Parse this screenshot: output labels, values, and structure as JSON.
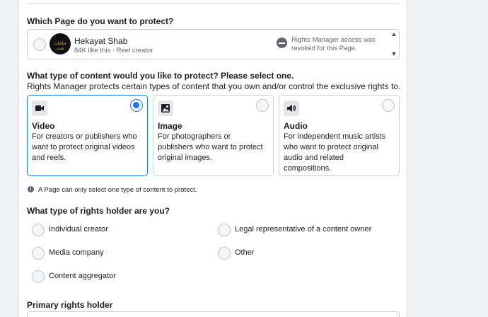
{
  "page_question": {
    "title": "Which Page do you want to protect?",
    "page": {
      "name": "Hekayat Shab",
      "meta": "84K like this · Reel creator",
      "avatar_text": "حكايات شب",
      "status": "Rights Manager access was revoked for this Page."
    }
  },
  "content_question": {
    "title": "What type of content would you like to protect? Please select one.",
    "subtitle": "Rights Manager protects certain types of content that you own and/or control the exclusive rights to.",
    "types": [
      {
        "title": "Video",
        "desc": "For creators or publishers who want to protect original videos and reels.",
        "selected": true,
        "icon": "video-camera-icon"
      },
      {
        "title": "Image",
        "desc": "For photographers or publishers who want to protect original images.",
        "selected": false,
        "icon": "image-icon"
      },
      {
        "title": "Audio",
        "desc": "For independent music artists who want to protect original audio and related compositions.",
        "selected": false,
        "icon": "speaker-icon"
      }
    ],
    "note": "A Page can only select one type of content to protect."
  },
  "holder_question": {
    "title": "What type of rights holder are you?",
    "options": [
      {
        "label": "Individual creator",
        "selected": false
      },
      {
        "label": "Legal representative of a content owner",
        "selected": false
      },
      {
        "label": "Media company",
        "selected": false
      },
      {
        "label": "Other",
        "selected": false
      },
      {
        "label": "Content aggregator",
        "selected": false
      }
    ]
  },
  "primary_holder": {
    "title": "Primary rights holder"
  },
  "colors": {
    "accent": "#1877f2",
    "border": "#ccd0d5",
    "muted": "#606770"
  }
}
